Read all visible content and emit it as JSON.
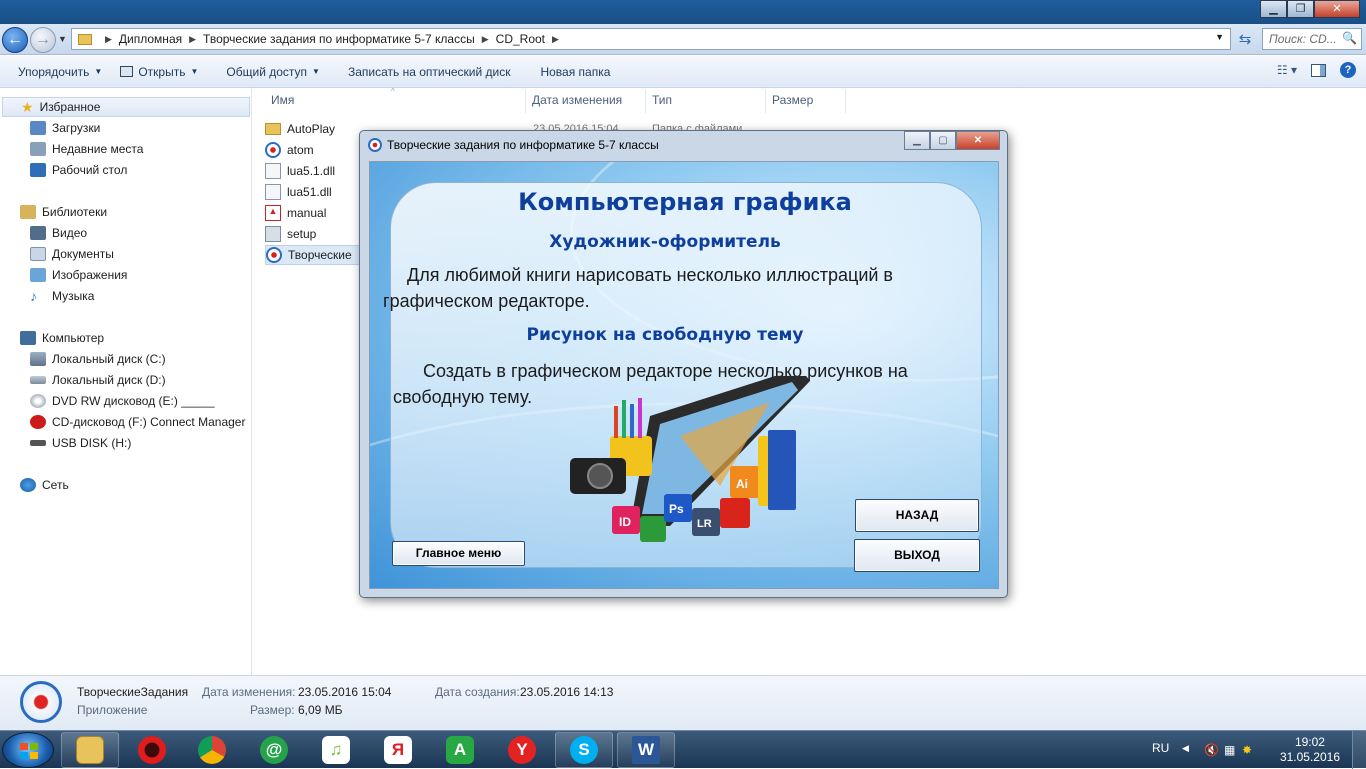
{
  "explorer": {
    "address": {
      "crumbs": [
        "Дипломная",
        "Творческие задания по информатике 5-7 классы",
        "CD_Root"
      ]
    },
    "search_placeholder": "Поиск: CD...",
    "toolbar": {
      "organize": "Упорядочить",
      "open": "Открыть",
      "share": "Общий доступ",
      "burn": "Записать на оптический диск",
      "new_folder": "Новая папка"
    },
    "nav": {
      "favorites": "Избранное",
      "downloads": "Загрузки",
      "recent": "Недавние места",
      "desktop": "Рабочий стол",
      "libraries": "Библиотеки",
      "video": "Видео",
      "documents": "Документы",
      "images": "Изображения",
      "music": "Музыка",
      "computer": "Компьютер",
      "disk_c": "Локальный диск (C:)",
      "disk_d": "Локальный диск (D:)",
      "dvd": "DVD RW дисковод (E:) _____",
      "cd": "CD-дисковод (F:) Connect Manager",
      "usb": "USB DISK (H:)",
      "network": "Сеть"
    },
    "columns": {
      "name": "Имя",
      "date": "Дата изменения",
      "type": "Тип",
      "size": "Размер"
    },
    "files": {
      "f0": "AutoPlay",
      "f1": "atom",
      "f2": "lua5.1.dll",
      "f3": "lua51.dll",
      "f4": "manual",
      "f5": "setup",
      "f6": "Творческие"
    },
    "partial": {
      "date0": "23.05.2016 15:04",
      "type0": "Папка с файлами"
    },
    "details": {
      "name": "ТворческиеЗадания",
      "kind": "Приложение",
      "mod_label": "Дата изменения:",
      "mod_value": "23.05.2016 15:04",
      "created_label": "Дата создания:",
      "created_value": "23.05.2016 14:13",
      "size_label": "Размер:",
      "size_value": "6,09 МБ"
    }
  },
  "dialog": {
    "title": "Творческие задания по информатике 5-7 классы",
    "heading": "Компьютерная графика",
    "sub1": "Художник-оформитель",
    "text1_line1": "Для любимой книги нарисовать несколько иллюстраций в",
    "text1_line2": "графическом редакторе.",
    "sub2": "Рисунок на свободную тему",
    "text2_line1": "Создать в графическом редакторе несколько рисунков на",
    "text2_line2": "свободную тему.",
    "btn_back": "НАЗАД",
    "btn_exit": "ВЫХОД",
    "btn_menu": "Главное меню"
  },
  "taskbar": {
    "lang": "RU",
    "time": "19:02",
    "date": "31.05.2016"
  },
  "colors": {
    "accent": "#0e3f9c",
    "taskbar": "#1b3654"
  }
}
